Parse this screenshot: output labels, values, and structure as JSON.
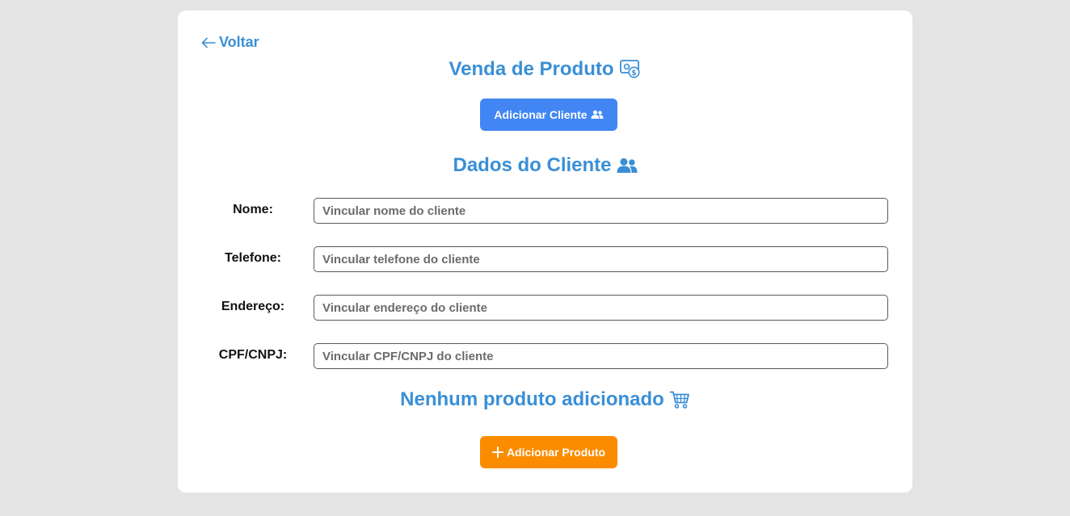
{
  "back": {
    "label": "Voltar"
  },
  "page": {
    "title": "Venda de Produto",
    "add_client_label": "Adicionar Cliente"
  },
  "client_section": {
    "title": "Dados do Cliente",
    "fields": [
      {
        "label": "Nome:",
        "value": "",
        "placeholder": "Vincular nome do cliente"
      },
      {
        "label": "Telefone:",
        "value": "",
        "placeholder": "Vincular telefone do cliente"
      },
      {
        "label": "Endereço:",
        "value": "",
        "placeholder": "Vincular endereço do cliente"
      },
      {
        "label": "CPF/CNPJ:",
        "value": "",
        "placeholder": "Vincular CPF/CNPJ do cliente"
      }
    ]
  },
  "products_section": {
    "title": "Nenhum produto adicionado",
    "add_product_label": "Adicionar Produto"
  },
  "icons": {
    "back": "arrow-left-icon",
    "title": "money-check-dollar-icon",
    "client_button": "users-icon",
    "client_title": "users-icon",
    "products_title": "shopping-cart-icon",
    "product_button": "plus-icon"
  },
  "colors": {
    "accent_text": "#3a8fd6",
    "primary_button": "#4286f4",
    "secondary_button": "#fb8c00",
    "background": "#e4e4e4",
    "card": "#ffffff"
  }
}
